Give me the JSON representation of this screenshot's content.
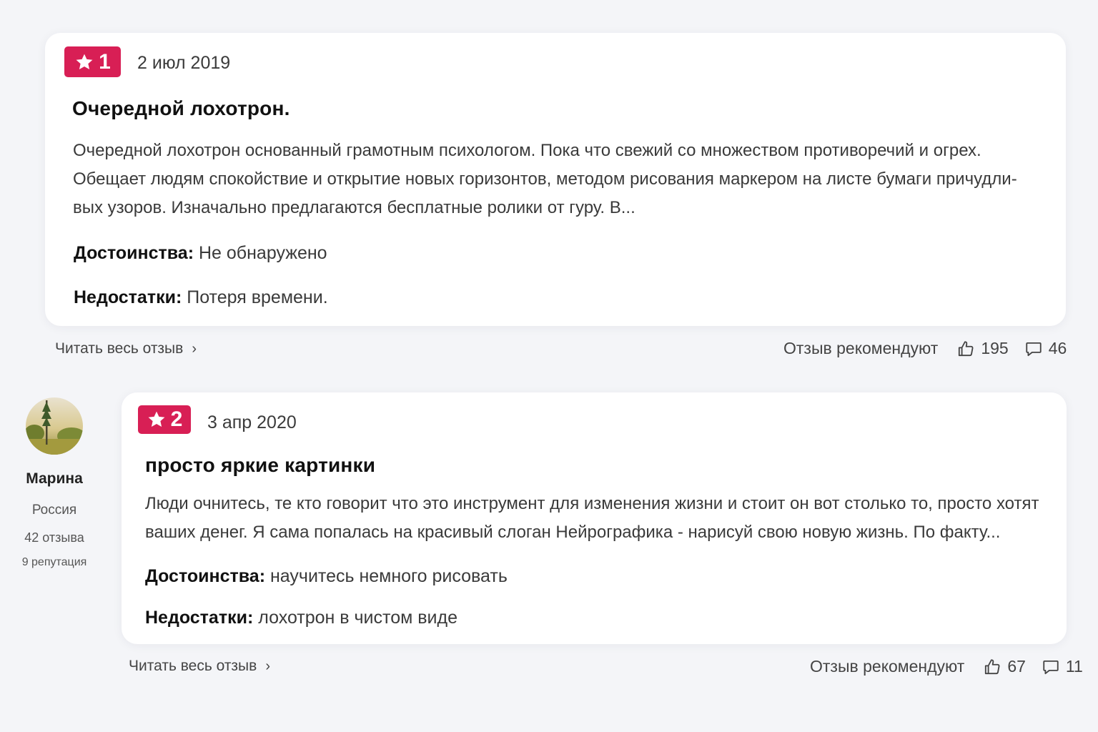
{
  "reviews": [
    {
      "rating": "1",
      "date": "2 июл 2019",
      "title": "Очередной лохотрон.",
      "body_lines": [
        "Очередной лохотрон основанный грамотным психологом. Пока что свежий со множеством противоречий и огрех.",
        "Обещает людям спокойствие и открытие новых горизонтов, методом рисования маркером на листе бумаги причудли-",
        "вых узоров. Изначально предлагаются бесплатные ролики от гуру. В..."
      ],
      "pros_label": "Достоинства:",
      "pros": "Не обнаружено",
      "cons_label": "Недостатки:",
      "cons": "Потеря времени.",
      "read_more": "Читать весь отзыв",
      "recommend_label": "Отзыв рекомендуют",
      "likes": "195",
      "comments": "46"
    },
    {
      "rating": "2",
      "date": "3 апр 2020",
      "title": "просто яркие картинки",
      "body_lines": [
        "Люди очнитесь, те кто говорит что это инструмент для изменения жизни и стоит он вот столько то, просто хотят",
        "ваших денег. Я сама попалась на красивый слоган Нейрографика - нарисуй свою новую жизнь. По факту..."
      ],
      "pros_label": "Достоинства:",
      "pros": "научитесь немного рисовать",
      "cons_label": "Недостатки:",
      "cons": "лохотрон в чистом виде",
      "read_more": "Читать весь отзыв",
      "recommend_label": "Отзыв рекомендуют",
      "likes": "67",
      "comments": "11",
      "author": {
        "name": "Марина",
        "country": "Россия",
        "reviews_count": "42 отзыва",
        "reputation": "9 репутация"
      }
    }
  ],
  "icons": {
    "rating": "star-icon",
    "likes": "thumbs-up-icon",
    "comments": "comment-icon",
    "read_more": "chevron-right-icon"
  },
  "colors": {
    "accent": "#d81f55",
    "background": "#f4f5f8",
    "card": "#ffffff"
  }
}
